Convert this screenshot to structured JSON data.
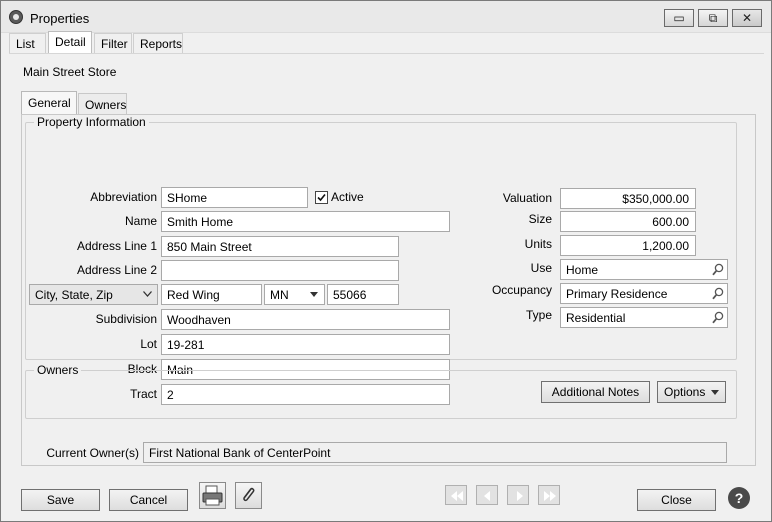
{
  "window": {
    "title": "Properties",
    "controls": {
      "minimize": "▭",
      "restore": "⧉",
      "close": "✕"
    }
  },
  "top_tabs": [
    "List",
    "Detail",
    "Filter",
    "Reports"
  ],
  "active_top_tab": "Detail",
  "record_name": "Main Street Store",
  "inner_tabs": [
    "General",
    "Owners"
  ],
  "active_inner_tab": "General",
  "property_info": {
    "legend": "Property Information",
    "abbreviation_label": "Abbreviation",
    "abbreviation_value": "SHome",
    "active_label": "Active",
    "active_checked": true,
    "name_label": "Name",
    "name_value": "Smith Home",
    "address1_label": "Address Line 1",
    "address1_value": "850 Main Street",
    "address2_label": "Address Line 2",
    "address2_value": "",
    "csz_selector": "City, State, Zip",
    "city_value": "Red Wing",
    "state_value": "MN",
    "zip_value": "55066",
    "subdivision_label": "Subdivision",
    "subdivision_value": "Woodhaven",
    "lot_label": "Lot",
    "lot_value": "19-281",
    "block_label": "Block",
    "block_value": "Main",
    "tract_label": "Tract",
    "tract_value": "2",
    "valuation_label": "Valuation",
    "valuation_value": "$350,000.00",
    "size_label": "Size",
    "size_value": "600.00",
    "units_label": "Units",
    "units_value": "1,200.00",
    "use_label": "Use",
    "use_value": "Home",
    "occupancy_label": "Occupancy",
    "occupancy_value": "Primary Residence",
    "type_label": "Type",
    "type_value": "Residential",
    "additional_notes_button": "Additional Notes",
    "options_button": "Options"
  },
  "owners": {
    "legend": "Owners",
    "current_owners_label": "Current Owner(s)",
    "current_owners_value": "First National Bank of CenterPoint"
  },
  "footer": {
    "save": "Save",
    "cancel": "Cancel",
    "close": "Close",
    "help": "?"
  },
  "icons": {
    "app": "app-logo-icon",
    "print": "print-icon",
    "attach": "paperclip-icon",
    "lookup": "magnifier-icon"
  },
  "colors": {
    "window_bg": "#f0f0f0",
    "border": "#a9a9a9",
    "help_bg": "#4a4a4a"
  }
}
